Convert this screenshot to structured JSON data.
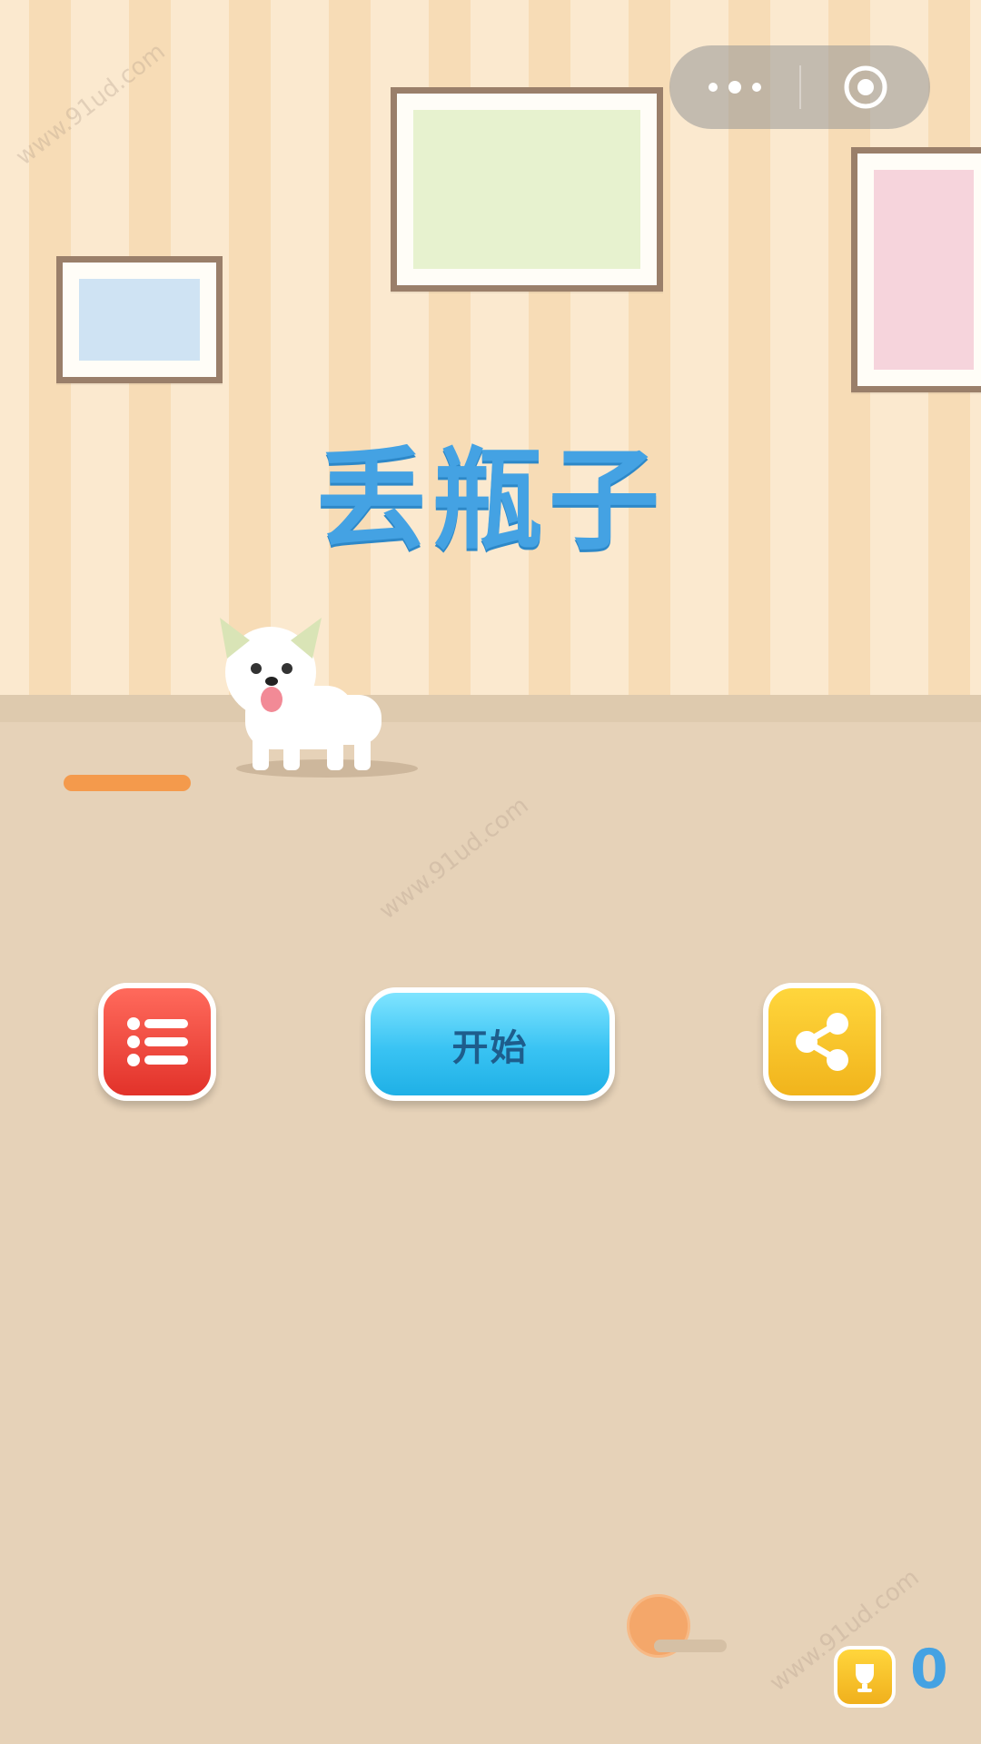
{
  "capsule": {
    "more_icon": "more-dots-icon",
    "close_icon": "target-circle-icon"
  },
  "title": "丢瓶子",
  "buttons": {
    "list_icon": "list-icon",
    "start_label": "开始",
    "share_icon": "share-icon"
  },
  "score": {
    "icon": "trophy-icon",
    "value": "0"
  },
  "watermark": "www.91ud.com",
  "colors": {
    "title": "#44a2e3",
    "start": "#39c3f3",
    "menu": "#e2322a",
    "share": "#f1b41c"
  }
}
